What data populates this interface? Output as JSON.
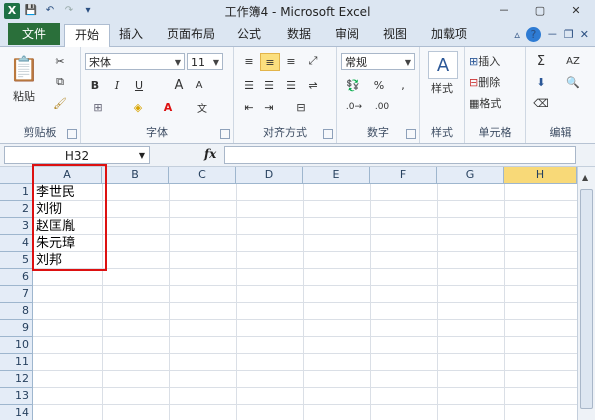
{
  "window": {
    "title": "工作簿4 - Microsoft Excel",
    "qat": {
      "excel_logo": "X"
    },
    "controls": [
      "－",
      "▢",
      "✕"
    ]
  },
  "tabs": {
    "file": "文件",
    "items": [
      "开始",
      "插入",
      "页面布局",
      "公式",
      "数据",
      "审阅",
      "视图",
      "加载项"
    ],
    "active": "开始"
  },
  "ribbon": {
    "clipboard": {
      "label": "剪贴板",
      "paste": "粘贴"
    },
    "font": {
      "label": "字体",
      "font_name": "宋体",
      "font_size": "11"
    },
    "alignment": {
      "label": "对齐方式"
    },
    "number": {
      "label": "数字",
      "format": "常规"
    },
    "styles": {
      "label": "样式",
      "button": "样式"
    },
    "cells": {
      "label": "单元格",
      "insert": "插入",
      "delete": "删除",
      "format": "格式"
    },
    "editing": {
      "label": "编辑"
    }
  },
  "formula_bar": {
    "name_box": "H32",
    "fx": "fx",
    "value": ""
  },
  "sheet": {
    "columns": [
      "A",
      "B",
      "C",
      "D",
      "E",
      "F",
      "G",
      "H"
    ],
    "highlighted_column": "H",
    "rows": [
      "1",
      "2",
      "3",
      "4",
      "5",
      "6",
      "7",
      "8",
      "9",
      "10",
      "11",
      "12",
      "13",
      "14"
    ],
    "cells_A": [
      "李世民",
      "刘彻",
      "赵匡胤",
      "朱元璋",
      "刘邦"
    ]
  },
  "colors": {
    "accent": "#2a6f3a",
    "highlight_box": "#dd1111",
    "selected_col": "#f8d978"
  }
}
